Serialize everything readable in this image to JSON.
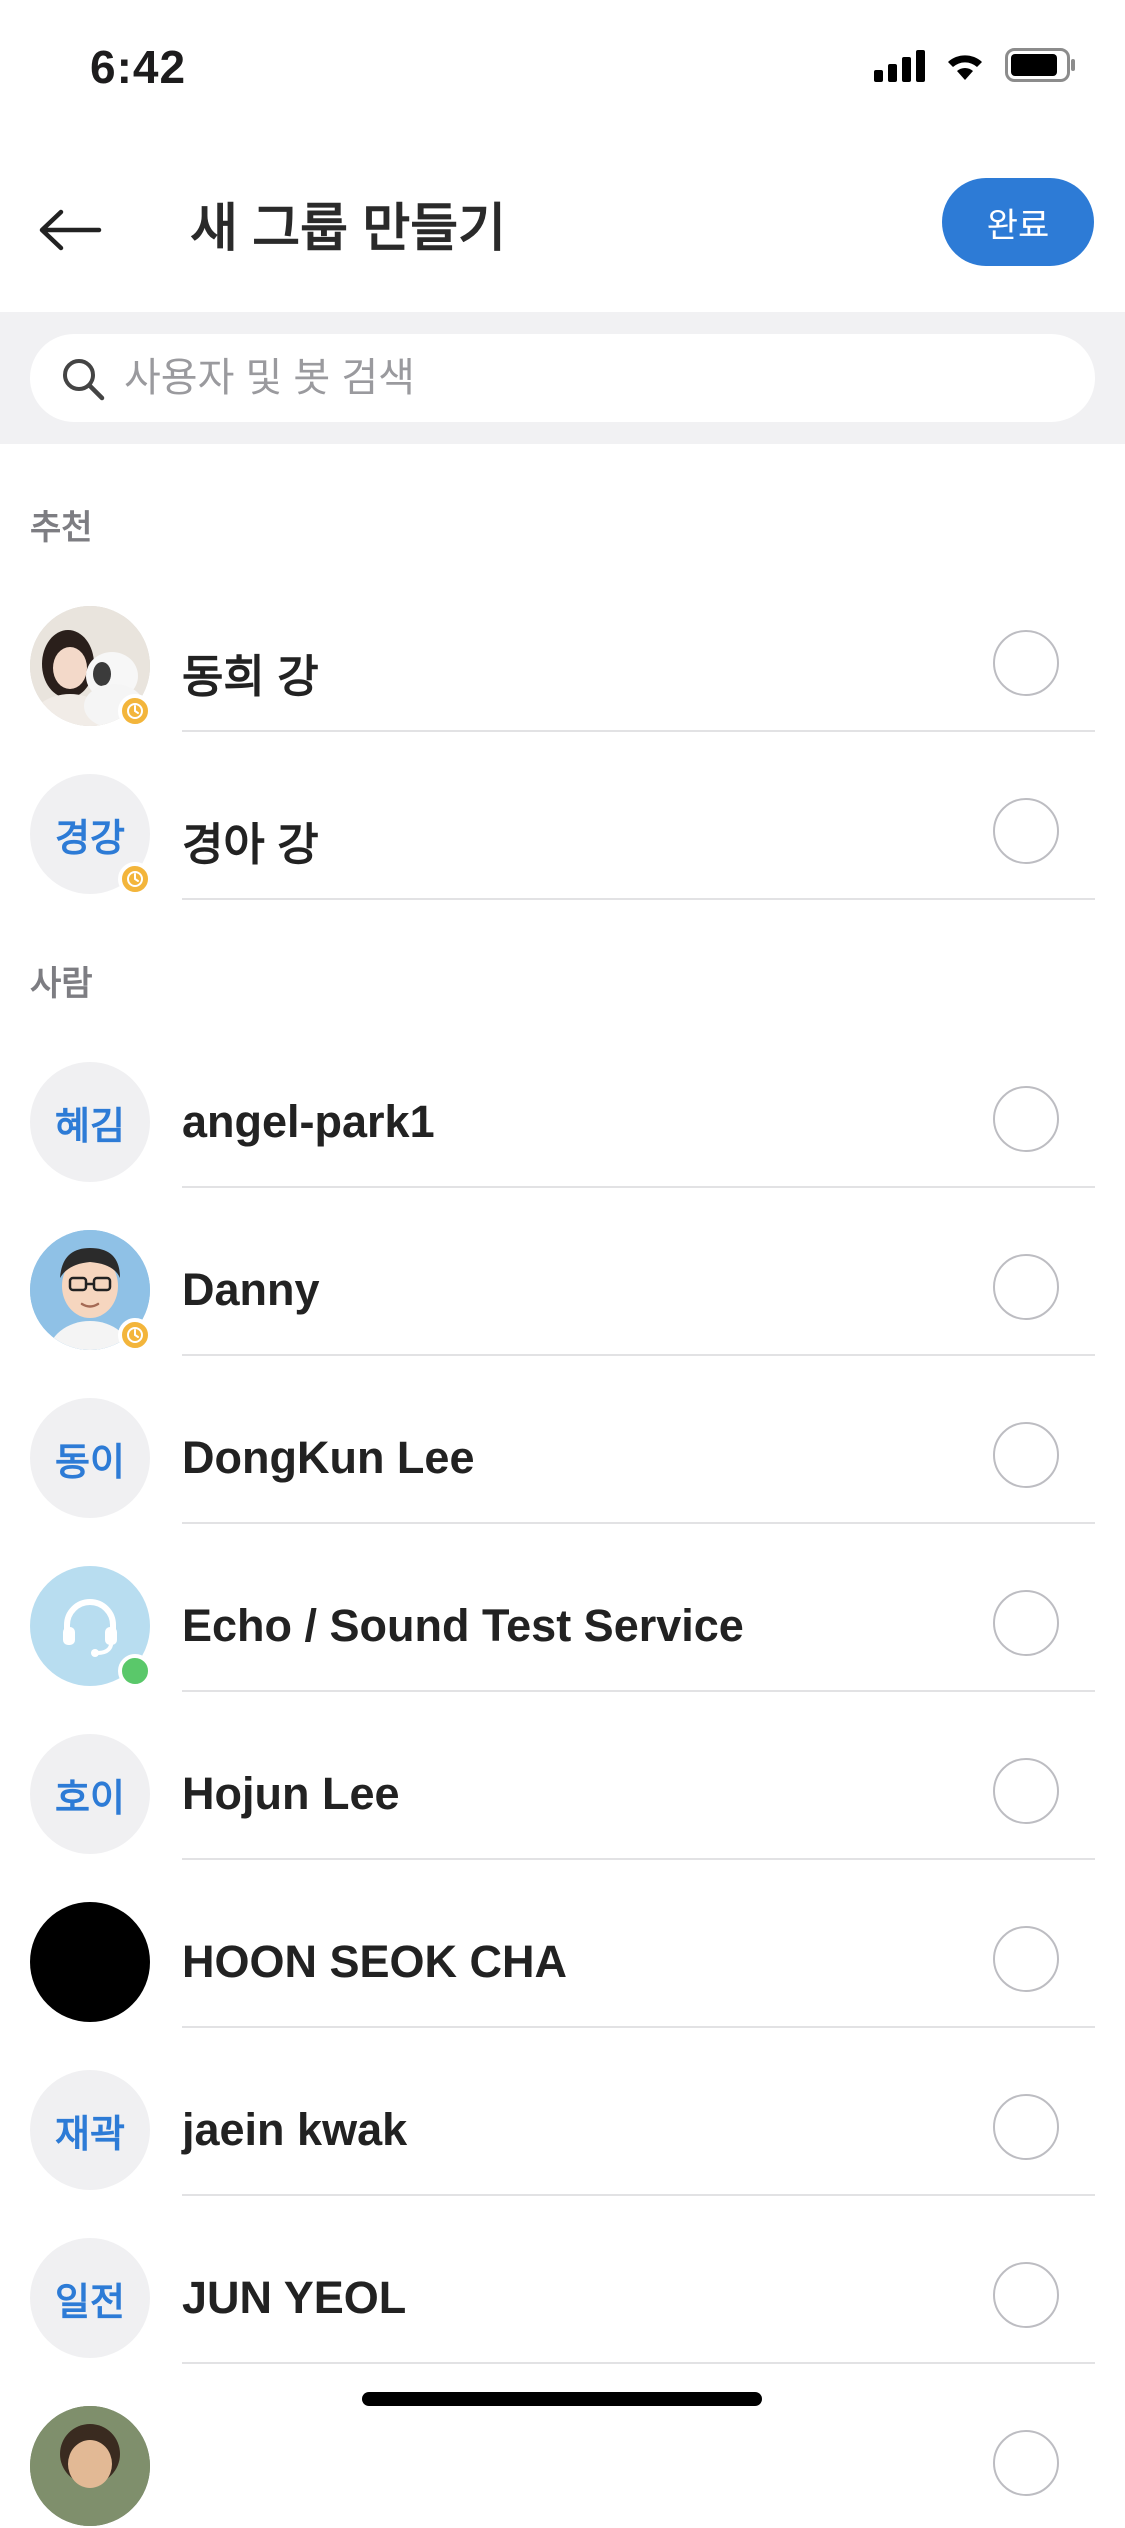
{
  "status_bar": {
    "time": "6:42"
  },
  "header": {
    "title": "새 그룹 만들기",
    "done_label": "완료"
  },
  "search": {
    "placeholder": "사용자 및 봇 검색"
  },
  "sections": {
    "recommended_label": "추천",
    "people_label": "사람"
  },
  "recommended": [
    {
      "name": "동희 강",
      "avatar": "photo",
      "status": "away"
    },
    {
      "name": "경아 강",
      "initials": "경강",
      "status": "away"
    }
  ],
  "people": [
    {
      "name": "angel-park1",
      "initials": "혜김"
    },
    {
      "name": "Danny",
      "avatar": "cartoon",
      "status": "away"
    },
    {
      "name": "DongKun Lee",
      "initials": "동이"
    },
    {
      "name": "Echo / Sound Test Service",
      "avatar": "headset-icon",
      "status": "online"
    },
    {
      "name": "Hojun Lee",
      "initials": "호이"
    },
    {
      "name": "HOON SEOK CHA",
      "avatar": "black"
    },
    {
      "name": "jaein kwak",
      "initials": "재곽"
    },
    {
      "name": "JUN YEOL",
      "initials": "일전"
    }
  ],
  "colors": {
    "accent": "#2d7bd6",
    "away": "#f3b53b",
    "online": "#5ac86a"
  }
}
